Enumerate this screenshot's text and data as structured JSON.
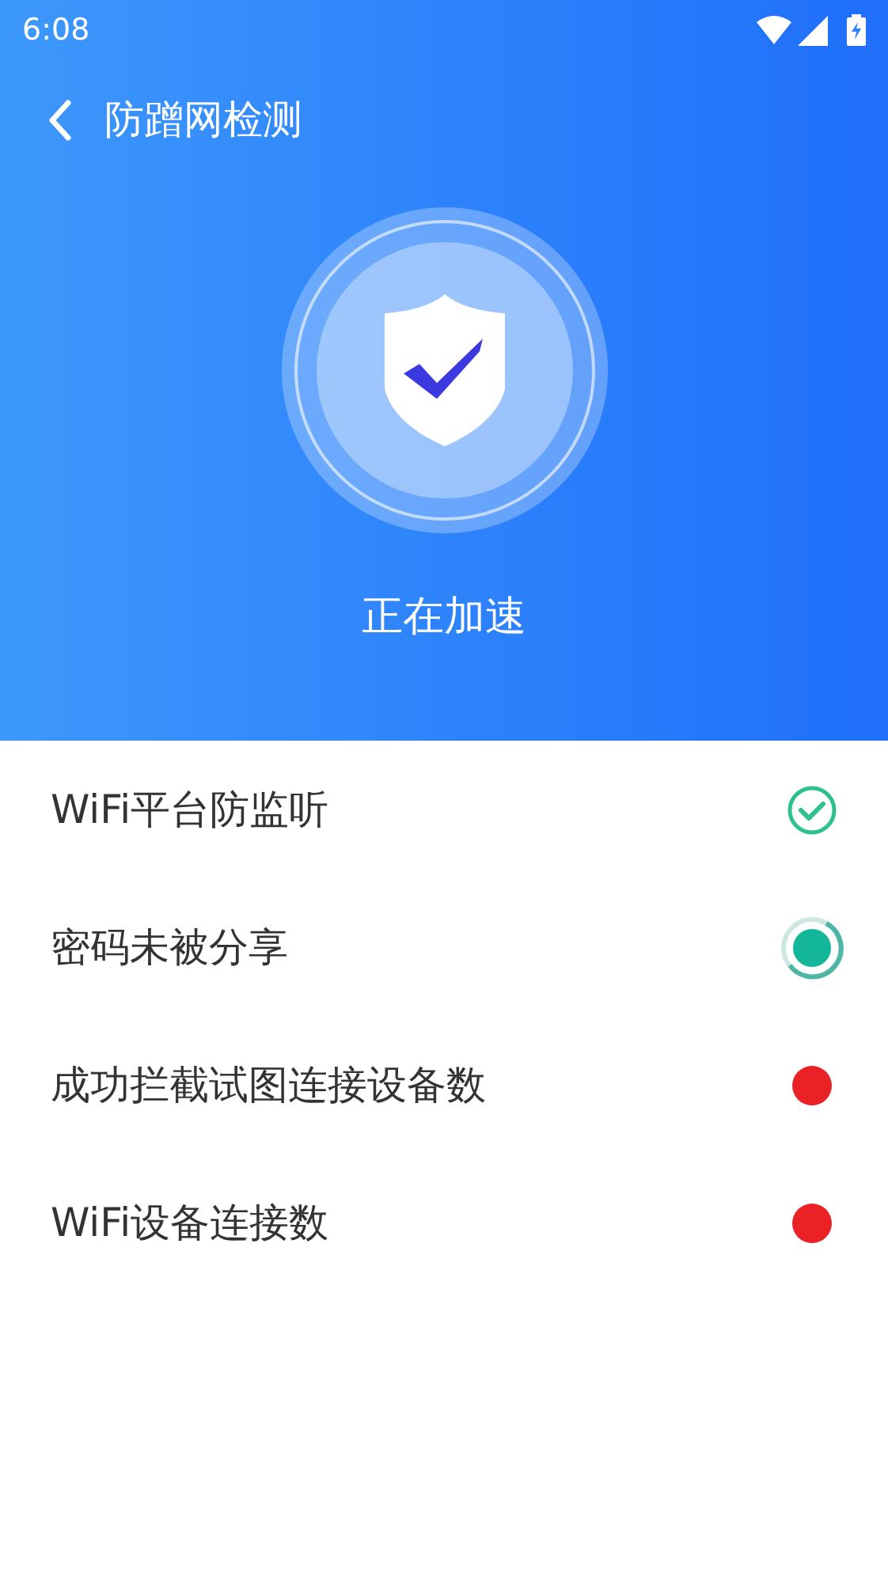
{
  "status_bar": {
    "time": "6:08"
  },
  "header": {
    "title": "防蹭网检测"
  },
  "hero": {
    "caption": "正在加速"
  },
  "checks": [
    {
      "label": "WiFi平台防监听",
      "kind": "done"
    },
    {
      "label": "密码未被分享",
      "kind": "running"
    },
    {
      "label": "成功拦截试图连接设备数",
      "kind": "pending"
    },
    {
      "label": "WiFi设备连接数",
      "kind": "pending"
    }
  ]
}
